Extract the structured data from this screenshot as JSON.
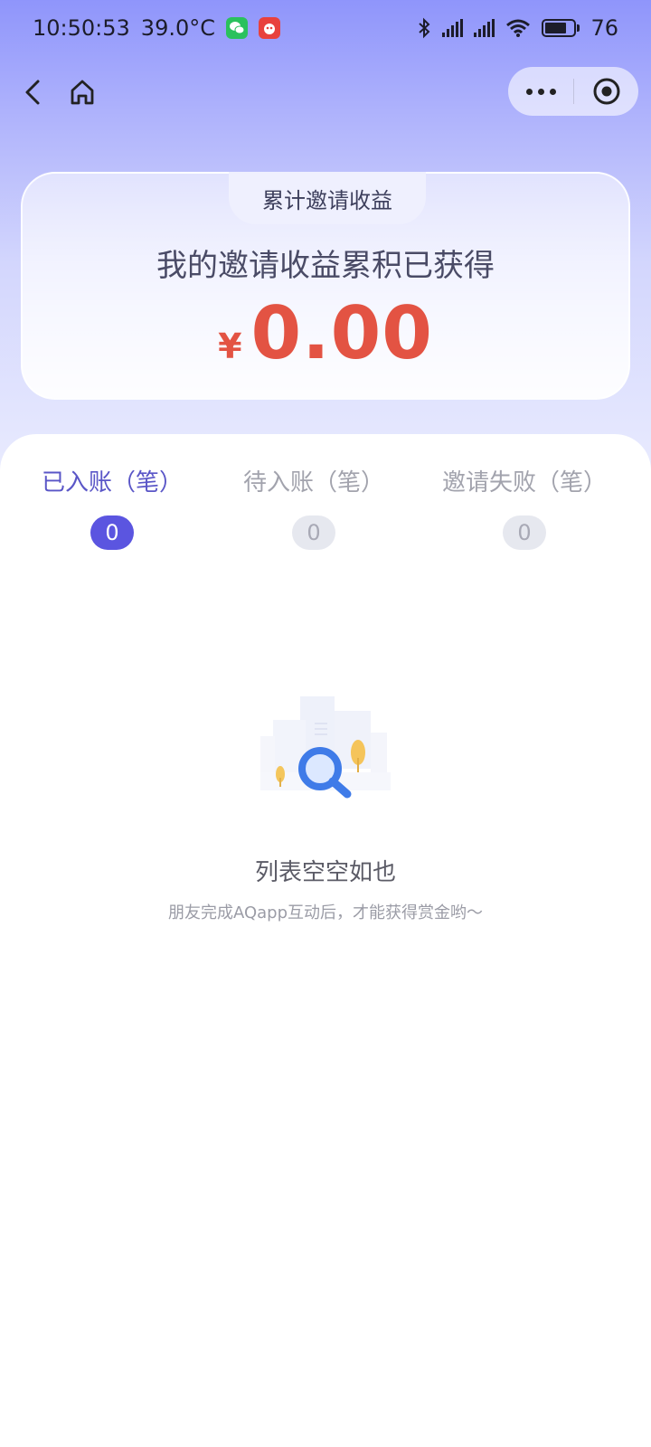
{
  "status_bar": {
    "time": "10:50:53",
    "temperature": "39.0°C",
    "battery": "76",
    "icons": [
      "wechat-app-icon",
      "red-app-icon",
      "bluetooth-icon",
      "signal-icon",
      "signal-icon",
      "wifi-icon",
      "battery-icon"
    ]
  },
  "nav": {
    "icons": [
      "back-icon",
      "home-icon",
      "more-icon",
      "target-icon"
    ]
  },
  "summary": {
    "tab_label": "累计邀请收益",
    "subtitle": "我的邀请收益累积已获得",
    "currency": "¥",
    "amount": "0.00"
  },
  "tabs": [
    {
      "label": "已入账（笔）",
      "count": "0",
      "active": true
    },
    {
      "label": "待入账（笔）",
      "count": "0",
      "active": false
    },
    {
      "label": "邀请失败（笔）",
      "count": "0",
      "active": false
    }
  ],
  "empty": {
    "title": "列表空空如也",
    "description": "朋友完成AQapp互动后，才能获得赏金哟～",
    "icon": "search-empty-icon"
  },
  "colors": {
    "accent": "#5b55e0",
    "amount": "#e35343"
  }
}
